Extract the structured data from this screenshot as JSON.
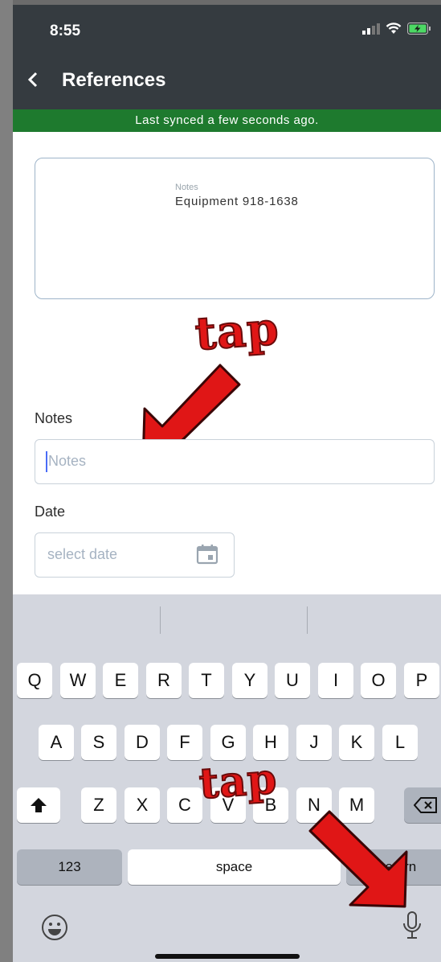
{
  "status_bar": {
    "time": "8:55"
  },
  "nav": {
    "title": "References"
  },
  "sync": {
    "text": "Last synced a few seconds ago."
  },
  "card": {
    "label": "Notes",
    "value": "Equipment 918-1638"
  },
  "form": {
    "notes_label": "Notes",
    "notes_placeholder": "Notes",
    "date_label": "Date",
    "date_placeholder": "select date"
  },
  "annotations": {
    "tap_top": "tap",
    "tap_bottom": "tap"
  },
  "keyboard": {
    "row1": [
      "Q",
      "W",
      "E",
      "R",
      "T",
      "Y",
      "U",
      "I",
      "O",
      "P"
    ],
    "row2": [
      "A",
      "S",
      "D",
      "F",
      "G",
      "H",
      "J",
      "K",
      "L"
    ],
    "row3": [
      "Z",
      "X",
      "C",
      "V",
      "B",
      "N",
      "M"
    ],
    "numbers_key": "123",
    "space_key": "space",
    "return_key": "return"
  },
  "colors": {
    "header": "#353b40",
    "sync_banner": "#1e7a2e",
    "arrow": "#e01616",
    "cursor": "#4a6cf7"
  },
  "icons": [
    "chevron-left-icon",
    "signal-icon",
    "wifi-icon",
    "battery-charging-icon",
    "calendar-icon",
    "shift-icon",
    "backspace-icon",
    "emoji-icon",
    "microphone-icon"
  ]
}
